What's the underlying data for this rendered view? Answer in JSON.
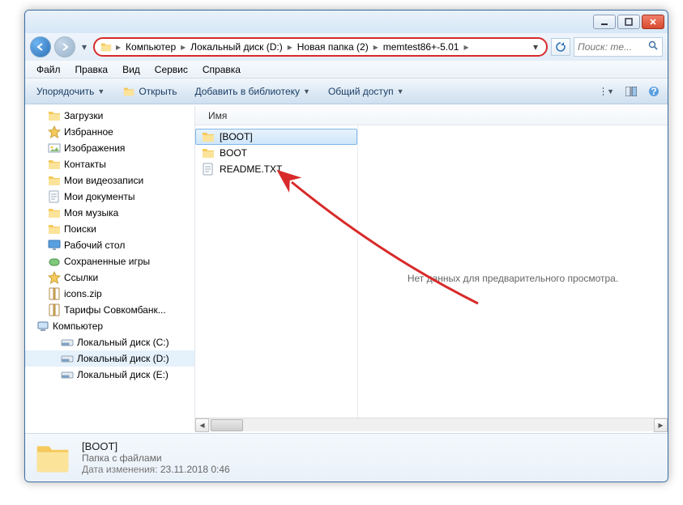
{
  "window_controls": {
    "min": "min",
    "max": "max",
    "close": "close"
  },
  "breadcrumb": {
    "items": [
      "Компьютер",
      "Локальный диск (D:)",
      "Новая папка (2)",
      "memtest86+-5.01"
    ]
  },
  "search": {
    "placeholder": "Поиск: те..."
  },
  "menubar": {
    "file": "Файл",
    "edit": "Правка",
    "view": "Вид",
    "tools": "Сервис",
    "help": "Справка"
  },
  "toolbar": {
    "organize": "Упорядочить",
    "open": "Открыть",
    "addlib": "Добавить в библиотеку",
    "share": "Общий доступ"
  },
  "sidebar": {
    "items": [
      {
        "label": "Загрузки",
        "icon": "folder"
      },
      {
        "label": "Избранное",
        "icon": "star-folder"
      },
      {
        "label": "Изображения",
        "icon": "pictures"
      },
      {
        "label": "Контакты",
        "icon": "contacts"
      },
      {
        "label": "Мои видеозаписи",
        "icon": "video"
      },
      {
        "label": "Мои документы",
        "icon": "docs"
      },
      {
        "label": "Моя музыка",
        "icon": "music"
      },
      {
        "label": "Поиски",
        "icon": "search-folder"
      },
      {
        "label": "Рабочий стол",
        "icon": "desktop"
      },
      {
        "label": "Сохраненные игры",
        "icon": "games"
      },
      {
        "label": "Ссылки",
        "icon": "star-folder"
      },
      {
        "label": "icons.zip",
        "icon": "zip"
      },
      {
        "label": "Тарифы Совкомбанк...",
        "icon": "zip"
      }
    ],
    "computer": "Компьютер",
    "drives": [
      {
        "label": "Локальный диск (C:)"
      },
      {
        "label": "Локальный диск (D:)",
        "selected": true
      },
      {
        "label": "Локальный диск (E:)"
      }
    ]
  },
  "list": {
    "header_name": "Имя",
    "files": [
      {
        "name": "[BOOT]",
        "icon": "folder",
        "selected": true
      },
      {
        "name": "BOOT",
        "icon": "folder"
      },
      {
        "name": "README.TXT",
        "icon": "txt"
      }
    ]
  },
  "preview": {
    "empty": "Нет данных для предварительного просмотра."
  },
  "details": {
    "name": "[BOOT]",
    "type": "Папка с файлами",
    "date_label": "Дата изменения:",
    "date_value": "23.11.2018 0:46"
  }
}
